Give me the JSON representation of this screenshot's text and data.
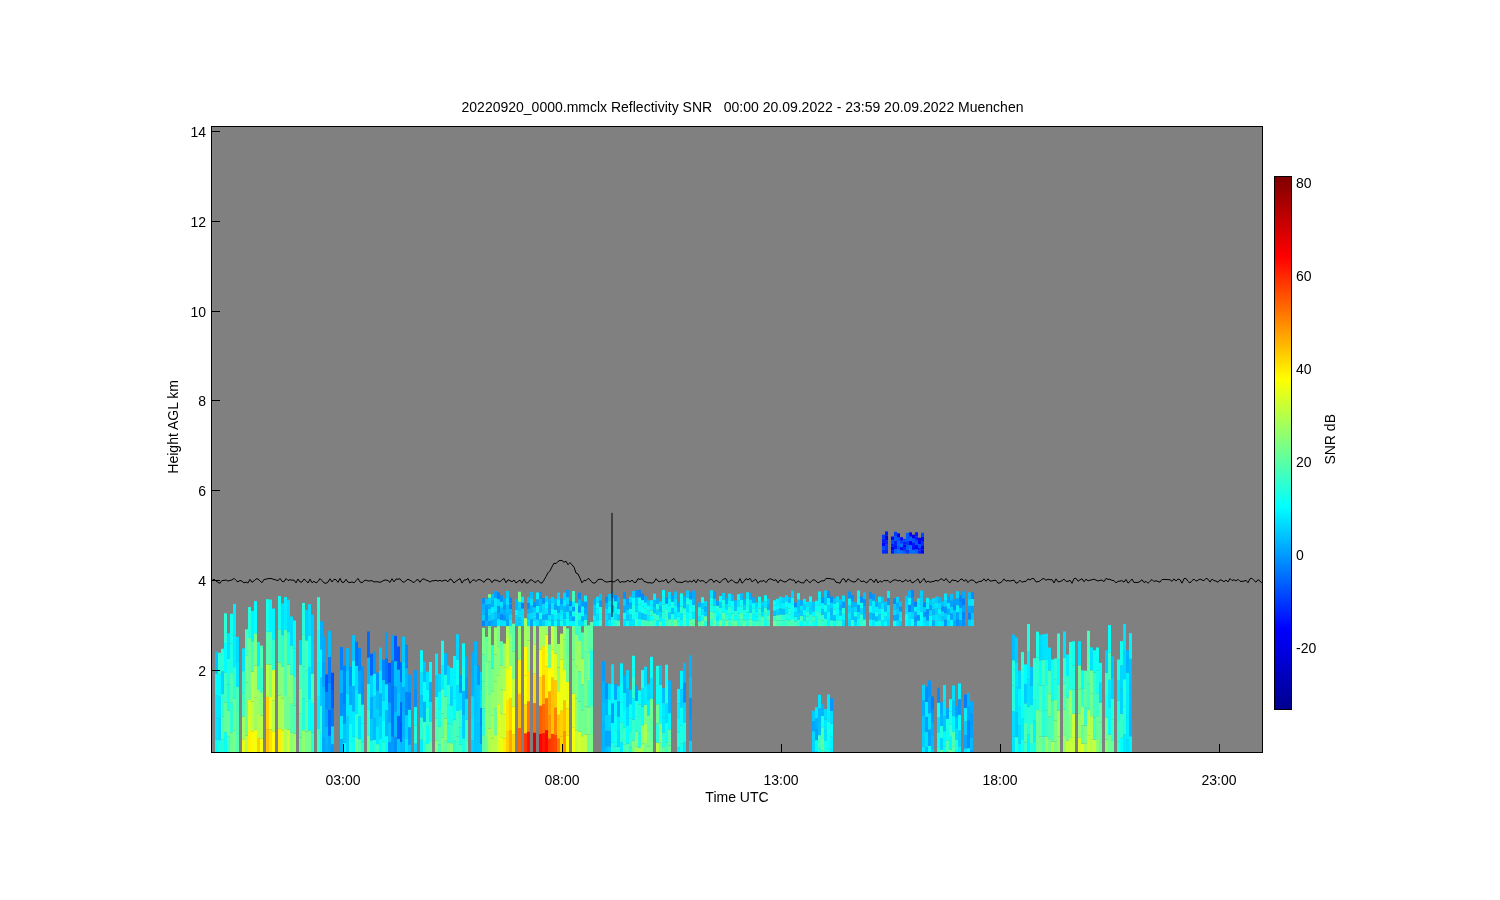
{
  "title": "20220920_0000.mmclx Reflectivity SNR   00:00 20.09.2022 - 23:59 20.09.2022 Muenchen",
  "y_axis": {
    "label": "Height AGL km",
    "ticks": [
      "14",
      "12",
      "10",
      "8",
      "6",
      "4",
      "2"
    ]
  },
  "x_axis": {
    "label": "Time UTC",
    "ticks": [
      "03:00",
      "08:00",
      "13:00",
      "18:00",
      "23:00"
    ]
  },
  "colorbar": {
    "label": "SNR dB",
    "ticks": [
      "80",
      "60",
      "40",
      "20",
      "0",
      "-20"
    ]
  }
}
